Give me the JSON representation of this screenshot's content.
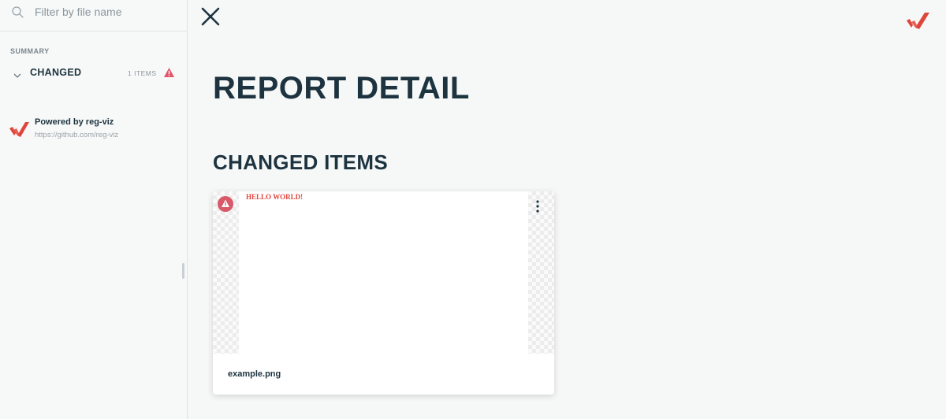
{
  "sidebar": {
    "search": {
      "placeholder": "Filter by file name",
      "icon": "search-icon"
    },
    "summary_label": "SUMMARY",
    "groups": [
      {
        "label": "CHANGED",
        "count": "1 ITEMS",
        "icon": "warning-icon",
        "expanded": true
      }
    ],
    "powered": {
      "title": "Powered by reg-viz",
      "link": "https://github.com/reg-viz"
    }
  },
  "main": {
    "title": "REPORT DETAIL",
    "section_title": "CHANGED ITEMS",
    "items": [
      {
        "filename": "example.png",
        "preview_text": "HELLO WORLD!",
        "status": "changed"
      }
    ]
  },
  "colors": {
    "text": "#1d3440",
    "accent": "#e0453b",
    "badge": "#d9586a",
    "background": "#f6f7f7"
  }
}
